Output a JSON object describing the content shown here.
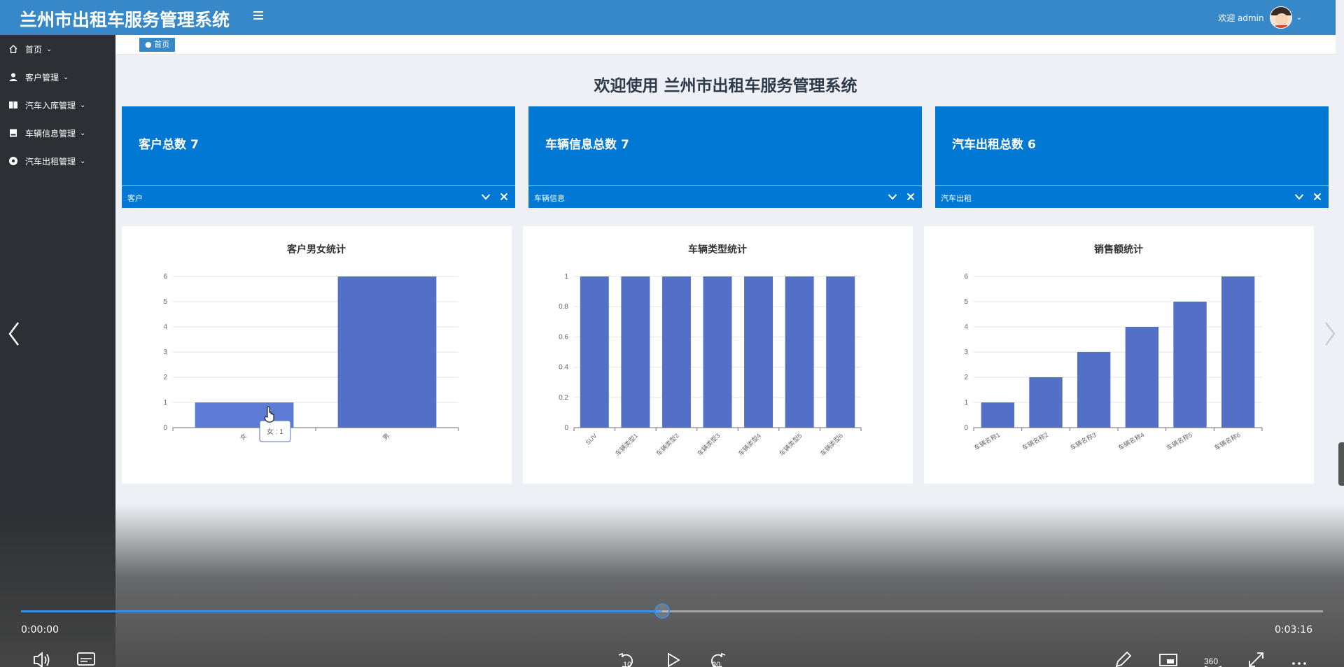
{
  "header": {
    "app_title": "兰州市出租车服务管理系统",
    "welcome_user": "欢迎 admin"
  },
  "sidebar": {
    "items": [
      {
        "label": "首页",
        "icon": "home-icon"
      },
      {
        "label": "客户管理",
        "icon": "user-icon"
      },
      {
        "label": "汽车入库管理",
        "icon": "book-icon"
      },
      {
        "label": "车辆信息管理",
        "icon": "document-icon"
      },
      {
        "label": "汽车出租管理",
        "icon": "circle-icon"
      }
    ]
  },
  "breadcrumb": {
    "label": "● 首页"
  },
  "page": {
    "welcome": "欢迎使用 兰州市出租车服务管理系统"
  },
  "stats": [
    {
      "title": "客户总数",
      "value": "7",
      "footer": "客户"
    },
    {
      "title": "车辆信息总数",
      "value": "7",
      "footer": "车辆信息"
    },
    {
      "title": "汽车出租总数",
      "value": "6",
      "footer": "汽车出租"
    }
  ],
  "colors": {
    "header": "#3688c8",
    "sidebar": "#2c2f33",
    "card": "#0078d4",
    "bar": "#5470c6",
    "bar_hover": "#5b7bd5",
    "progress": "#3f8fe0"
  },
  "chart_data": [
    {
      "type": "bar",
      "title": "客户男女统计",
      "categories": [
        "女",
        "男"
      ],
      "values": [
        1,
        6
      ],
      "ylim": [
        0,
        6
      ],
      "yticks": [
        "0",
        "1",
        "2",
        "3",
        "4",
        "5",
        "6"
      ],
      "tooltip": "女 : 1",
      "label_rotate": -45
    },
    {
      "type": "bar",
      "title": "车辆类型统计",
      "categories": [
        "SUV",
        "车辆类型1",
        "车辆类型2",
        "车辆类型3",
        "车辆类型4",
        "车辆类型5",
        "车辆类型6"
      ],
      "values": [
        1,
        1,
        1,
        1,
        1,
        1,
        1
      ],
      "ylim": [
        0,
        1
      ],
      "yticks": [
        "0",
        "0.2",
        "0.4",
        "0.6",
        "0.8",
        "1"
      ],
      "label_rotate": -45
    },
    {
      "type": "bar",
      "title": "销售额统计",
      "categories": [
        "车辆名称1",
        "车辆名称2",
        "车辆名称3",
        "车辆名称4",
        "车辆名称5",
        "车辆名称6"
      ],
      "values": [
        1,
        2,
        3,
        4,
        5,
        6
      ],
      "ylim": [
        0,
        6
      ],
      "yticks": [
        "0",
        "1",
        "2",
        "3",
        "4",
        "5",
        "6"
      ],
      "label_rotate": -30
    }
  ],
  "video": {
    "current_time": "0:00:00",
    "total_time": "0:03:16",
    "progress": 0.4925,
    "rewind_label": "10",
    "forward_label": "30",
    "vr_label": "360"
  }
}
